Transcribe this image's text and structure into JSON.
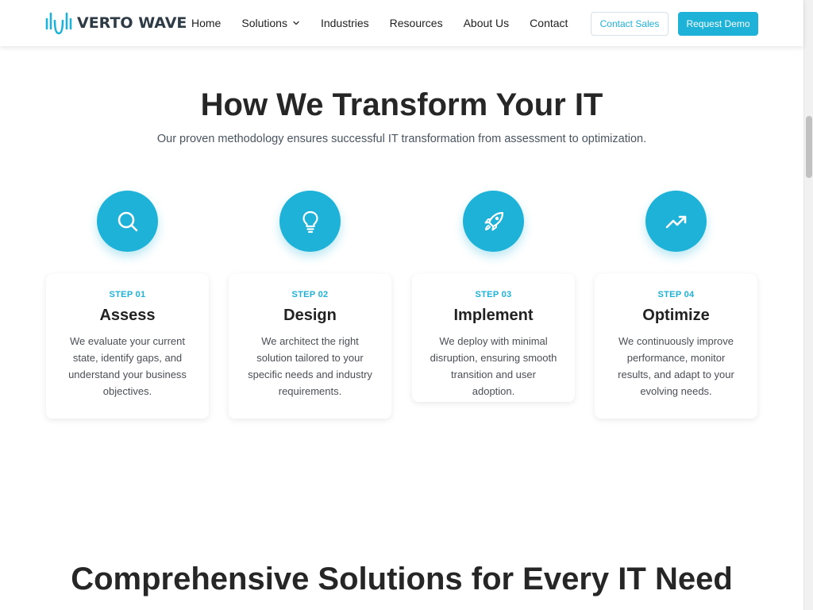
{
  "brand": {
    "name": "VERTO WAVE",
    "accent": "#1eb2d8"
  },
  "nav": {
    "items": [
      {
        "label": "Home"
      },
      {
        "label": "Solutions",
        "has_dropdown": true
      },
      {
        "label": "Industries"
      },
      {
        "label": "Resources"
      },
      {
        "label": "About Us"
      },
      {
        "label": "Contact"
      }
    ],
    "contact_sales": "Contact Sales",
    "request_demo": "Request Demo"
  },
  "section": {
    "title": "How We Transform Your IT",
    "subtitle": "Our proven methodology ensures successful IT transformation from assessment to optimization."
  },
  "steps": [
    {
      "icon": "search-icon",
      "label": "STEP 01",
      "title": "Assess",
      "description": "We evaluate your current state, identify gaps, and understand your business objectives."
    },
    {
      "icon": "lightbulb-icon",
      "label": "STEP 02",
      "title": "Design",
      "description": "We architect the right solution tailored to your specific needs and industry requirements."
    },
    {
      "icon": "rocket-icon",
      "label": "STEP 03",
      "title": "Implement",
      "description": "We deploy with minimal disruption, ensuring smooth transition and user adoption."
    },
    {
      "icon": "trending-up-icon",
      "label": "STEP 04",
      "title": "Optimize",
      "description": "We continuously improve performance, monitor results, and adapt to your evolving needs."
    }
  ],
  "next_section": {
    "title": "Comprehensive Solutions for Every IT Need"
  }
}
